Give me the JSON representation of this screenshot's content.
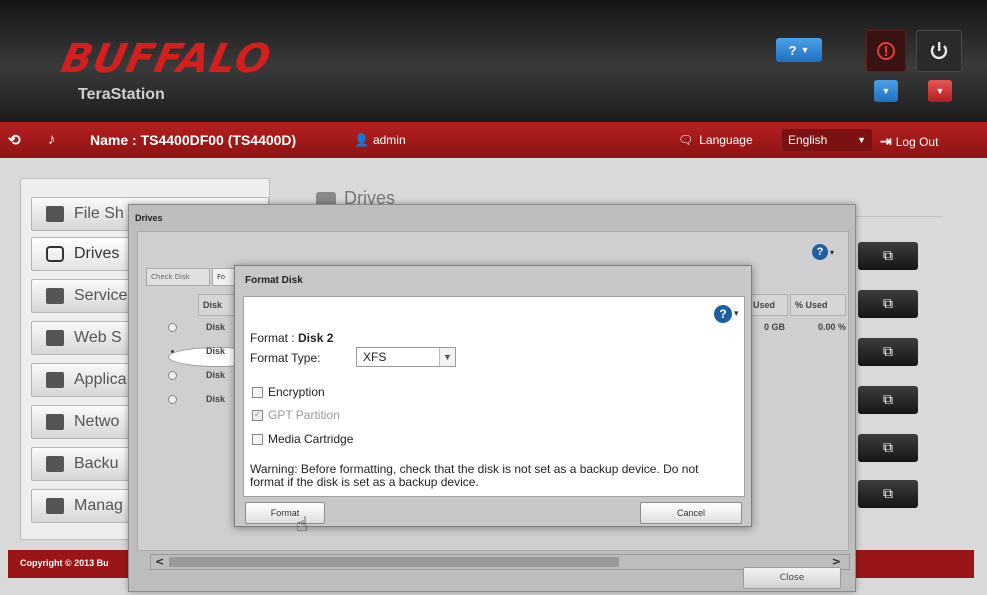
{
  "header": {
    "logo": "BUFFALO",
    "product": "TeraStation",
    "help_label": "?",
    "alert_icon": "alert-icon",
    "power_icon": "power-icon"
  },
  "topbar": {
    "device_name": "Name : TS4400DF00 (TS4400D)",
    "user": "admin",
    "language_label": "Language",
    "language_value": "English",
    "logout": "Log Out"
  },
  "sidebar": {
    "items": [
      {
        "label": "File Sh",
        "icon": "folder-icon"
      },
      {
        "label": "Drives",
        "icon": "drive-icon"
      },
      {
        "label": "Service",
        "icon": "services-icon"
      },
      {
        "label": "Web S",
        "icon": "web-icon"
      },
      {
        "label": "Applica",
        "icon": "apps-icon"
      },
      {
        "label": "Netwo",
        "icon": "network-icon"
      },
      {
        "label": "Backu",
        "icon": "backup-icon"
      },
      {
        "label": "Manag",
        "icon": "tools-icon"
      }
    ]
  },
  "main": {
    "heading": "Drives"
  },
  "footer": {
    "text": "Copyright © 2013 Bu"
  },
  "drives_dialog": {
    "title": "Drives",
    "tabs": [
      "Check Disk",
      "Fo"
    ],
    "columns": [
      "Disk",
      "Used",
      "% Used"
    ],
    "rows": [
      {
        "disk": "Disk",
        "used": "0 GB",
        "pct": "0.00 %",
        "selected": false
      },
      {
        "disk": "Disk",
        "used": "",
        "pct": "",
        "selected": true
      },
      {
        "disk": "Disk",
        "used": "",
        "pct": "",
        "selected": false
      },
      {
        "disk": "Disk",
        "used": "",
        "pct": "",
        "selected": false
      }
    ],
    "scroll_left": "<",
    "scroll_right": ">",
    "close_button": "Close"
  },
  "format_dialog": {
    "title": "Format Disk",
    "format_label": "Format :",
    "format_disk": "Disk 2",
    "type_label": "Format Type:",
    "type_value": "XFS",
    "encryption_label": "Encryption",
    "gpt_label": "GPT Partition",
    "media_label": "Media Cartridge",
    "warning_line1": "Warning: Before formatting, check that the disk is not set as a backup device. Do not",
    "warning_line2": "format if the disk is set as a backup device.",
    "format_button": "Format",
    "cancel_button": "Cancel"
  }
}
